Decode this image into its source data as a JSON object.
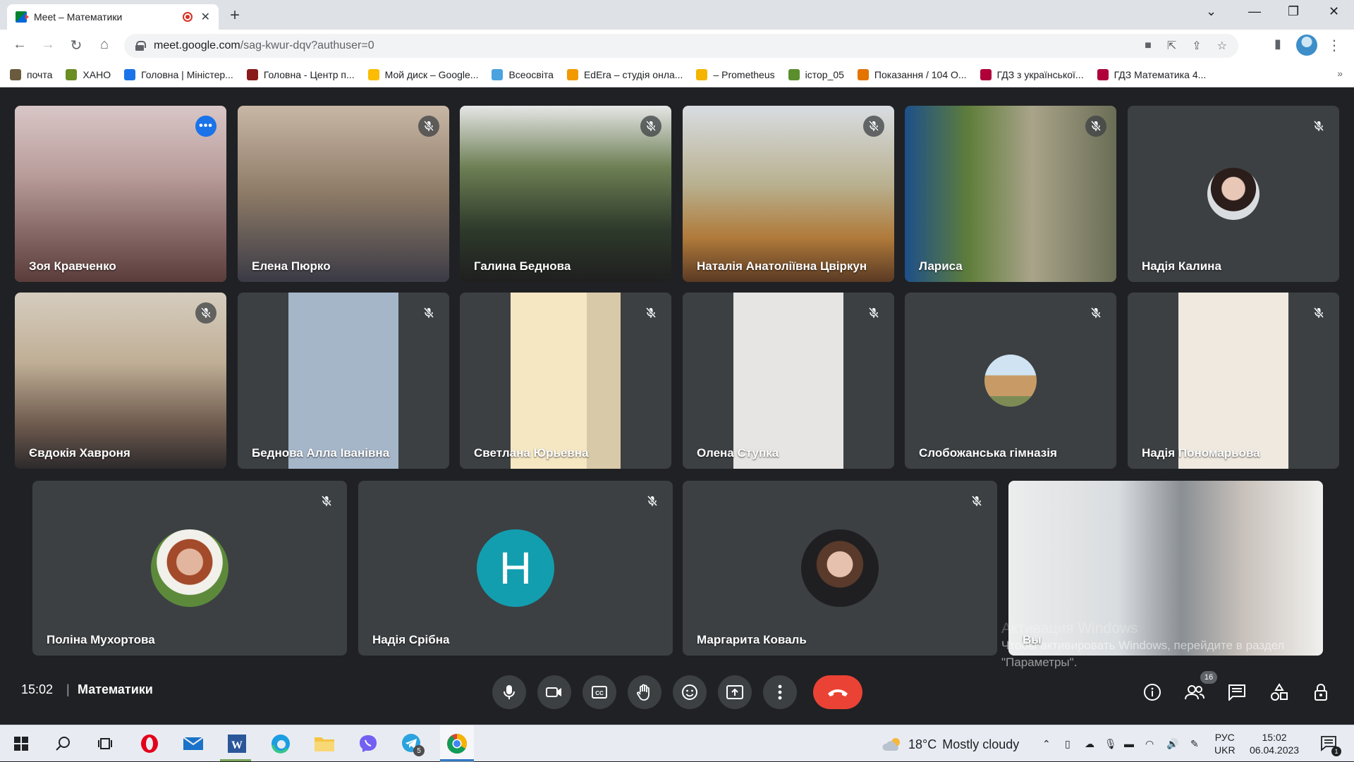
{
  "browser": {
    "tab_title": "Meet – Математики",
    "url_host": "meet.google.com",
    "url_path": "/sag-kwur-dqv?authuser=0",
    "bookmarks": [
      {
        "label": "почта",
        "color": "#6b5b3e"
      },
      {
        "label": "ХАНО",
        "color": "#6b8e23"
      },
      {
        "label": "Головна | Міністер...",
        "color": "#1a73e8"
      },
      {
        "label": "Головна - Центр п...",
        "color": "#8b1a1a"
      },
      {
        "label": "Мой диск – Google...",
        "color": "#fbbc04"
      },
      {
        "label": "Всеосвіта",
        "color": "#4aa3df"
      },
      {
        "label": "EdEra – студія онла...",
        "color": "#f29900"
      },
      {
        "label": "– Prometheus",
        "color": "#f4b400"
      },
      {
        "label": "істор_05",
        "color": "#5b8f2e"
      },
      {
        "label": "Показання / 104 О...",
        "color": "#e37400"
      },
      {
        "label": "ГДЗ з української...",
        "color": "#b0003a"
      },
      {
        "label": "ГДЗ Математика 4...",
        "color": "#b0003a"
      }
    ],
    "more_label": "»"
  },
  "participants": [
    {
      "name": "Зоя Кравченко",
      "bg": "linear-gradient(180deg,#d8c6c6 0%,#b89c9a 40%,#5a3c3a 100%)",
      "active": true
    },
    {
      "name": "Елена Пюрко",
      "bg": "linear-gradient(180deg,#c9b7a6 0%,#8d7a66 50%,#3a3a45 100%)"
    },
    {
      "name": "Галина Беднова",
      "bg": "linear-gradient(180deg,#e6e6e6 0%,#6d7f54 35%,#2e3a2b 70%,#1f1f1f 100%)"
    },
    {
      "name": "Наталія Анатоліївна Цвіркун",
      "bg": "linear-gradient(180deg,#d9dde2 0%,#b8b08f 45%,#b07a3a 75%,#5a3a24 100%)"
    },
    {
      "name": "Лариса",
      "bg": "linear-gradient(90deg,#1d4f8a 0%,#5f7d3a 30%,#a9a48a 60%,#6a6d55 100%)"
    },
    {
      "name": "Надія Калина",
      "avatar": {
        "kind": "photo",
        "size": 74,
        "bg": "radial-gradient(circle at 50% 40%,#e8c7b6 0 28%,#2a1d1a 30% 55%,#d9dde0 56% 100%)"
      }
    },
    {
      "name": "Євдокія Хавроня",
      "bg": "linear-gradient(180deg,#d6cdbf 0%,#bfae95 40%,#6e5a4e 75%,#2c2a2b 100%)"
    },
    {
      "name": "Беднова Алла Іванівна",
      "bg": "linear-gradient(90deg,#3c4043 0 24%,#a5b6c9 24% 76%,#3c4043 76% 100%)"
    },
    {
      "name": "Светлана Юрьевна",
      "bg": "linear-gradient(90deg,#3c4043 0 24%,#f6e7c3 24% 60%,#d8c9a8 60% 76%,#3c4043 76% 100%)"
    },
    {
      "name": "Олена Ступка",
      "bg": "linear-gradient(90deg,#3c4043 0 24%,#e7e5e3 24% 76%,#3c4043 76% 100%)"
    },
    {
      "name": "Слобожанська гімназія",
      "avatar": {
        "kind": "photo",
        "size": 74,
        "bg": "linear-gradient(180deg,#cfe3f2 0 40%,#c89b66 40% 80%,#7d8c55 80% 100%)"
      }
    },
    {
      "name": "Надія Пономарьова",
      "bg": "linear-gradient(90deg,#3c4043 0 24%,#efe9df 24% 76%,#3c4043 76% 100%)"
    },
    {
      "name": "Поліна Мухортова",
      "avatar": {
        "kind": "photo",
        "size": 110,
        "bg": "radial-gradient(circle at 50% 42%,#e2b69e 0 22%,#a34a2a 23% 38%,#f2f0ea 39% 55%,#5c8a3a 56% 100%)"
      }
    },
    {
      "name": "Надія Срібна",
      "avatar": {
        "kind": "letter",
        "size": 110,
        "letter": "Н"
      }
    },
    {
      "name": "Маргарита Коваль",
      "avatar": {
        "kind": "photo",
        "size": 110,
        "bg": "radial-gradient(circle at 50% 45%,#e6c1ad 0 22%,#5a3a2a 23% 40%,#1f1f22 41% 100%)"
      }
    },
    {
      "name": "Вы",
      "bg": "linear-gradient(90deg,#eceded 0%,#d9dcdf 35%,#8a8f94 55%,#c9c2bc 75%,#f1f0ee 100%)"
    }
  ],
  "bottom": {
    "time": "15:02",
    "separator": "|",
    "meeting_name": "Математики",
    "people_count": "16"
  },
  "watermark": {
    "line1": "Активация Windows",
    "line2": "Чтобы активировать Windows, перейдите в раздел",
    "line3": "\"Параметры\"."
  },
  "taskbar": {
    "temperature": "18°C",
    "weather": "Mostly cloudy",
    "lang_top": "РУС",
    "lang_bottom": "UKR",
    "clock_time": "15:02",
    "clock_date": "06.04.2023",
    "telegram_badge": "5",
    "notif_count": "1"
  }
}
